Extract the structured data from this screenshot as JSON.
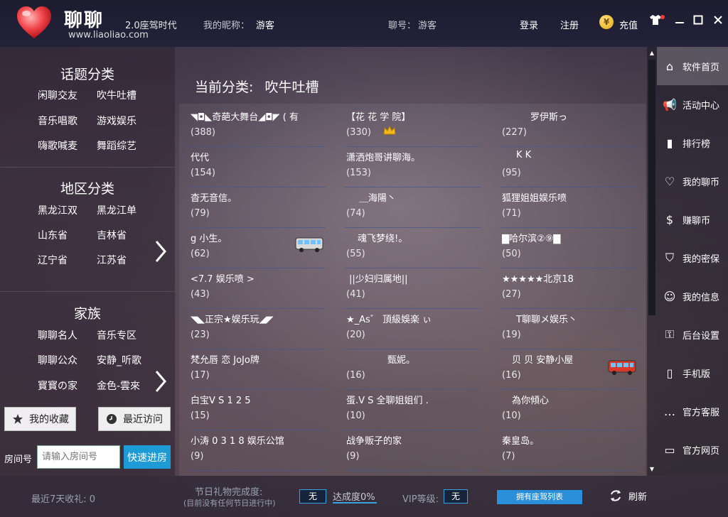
{
  "titlebar": {
    "brand": "聊聊",
    "version": "2.0座驾时代",
    "website": "www.liaoliao.com",
    "nick_label": "我的昵称：",
    "nick_value": "游客",
    "account_label": "聊号：",
    "account_value": "游客",
    "login": "登录",
    "register": "注册",
    "recharge": "充值",
    "coin_glyph": "¥"
  },
  "left": {
    "topics": {
      "title": "话题分类",
      "items": [
        "闲聊交友",
        "吹牛吐槽",
        "音乐唱歌",
        "游戏娱乐",
        "嗨歌喊麦",
        "舞蹈综艺"
      ]
    },
    "regions": {
      "title": "地区分类",
      "items": [
        "黑龙江双",
        "黑龙江单",
        "山东省",
        "吉林省",
        "辽宁省",
        "江苏省"
      ]
    },
    "family": {
      "title": "家族",
      "items": [
        "聊聊名人",
        "音乐专区",
        "聊聊公众",
        "安静_听歌",
        "寳寳の家",
        "金色-雲來"
      ]
    },
    "favorites": "我的收藏",
    "recent": "最近访问",
    "room_label": "房间号",
    "room_placeholder": "请输入房间号",
    "enter_room": "快速进房"
  },
  "main": {
    "current_label": "当前分类:",
    "current_value": "吹牛吐槽",
    "rooms": [
      {
        "name": "◥◘◣奇葩大舞台◢◘◤ ( 有",
        "count": "(388)"
      },
      {
        "name": "【花 花 学 院】",
        "count": "(330)"
      },
      {
        "name": "罗伊斯っ",
        "count": "(227)"
      },
      {
        "name": "代代",
        "count": "(154)"
      },
      {
        "name": "潇洒炮哥讲聊海。",
        "count": "(153)"
      },
      {
        "name": "K  K",
        "count": "(95)"
      },
      {
        "name": "杳无音信。",
        "count": "(79)"
      },
      {
        "name": "＿海陽丶",
        "count": "(74)"
      },
      {
        "name": "狐狸姐姐娱乐喷",
        "count": "(71)"
      },
      {
        "name": "g 小生。",
        "count": "(62)"
      },
      {
        "name": "魂飞梦绕!。",
        "count": "(55)"
      },
      {
        "name": "▇哈尔滨②⑨▇",
        "count": "(50)"
      },
      {
        "name": "<7.7 娱乐喷 >",
        "count": "(43)"
      },
      {
        "name": "||少妇归属地||",
        "count": "(41)"
      },
      {
        "name": "★★★★★北京18",
        "count": "(27)"
      },
      {
        "name": "◥◣正宗★娱乐玩◢◤",
        "count": "(23)"
      },
      {
        "name": "★_As゛ 頂級娛楽 ぃ",
        "count": "(20)"
      },
      {
        "name": "T聊聊メ娱乐丶",
        "count": "(19)"
      },
      {
        "name": "梵允唇 恋 JoJo牌",
        "count": "(17)"
      },
      {
        "name": "甄妮。",
        "count": "(16)"
      },
      {
        "name": "贝 贝  安静小屋",
        "count": "(16)"
      },
      {
        "name": "白宝V S 1 2 5",
        "count": "(15)"
      },
      {
        "name": "蛋.V S 全聊姐姐们 .",
        "count": "(10)"
      },
      {
        "name": "為你傾心",
        "count": "(10)"
      },
      {
        "name": "小涛 0 3 1 8 娱乐公馆",
        "count": "(9)"
      },
      {
        "name": "战争贩子的家",
        "count": "(9)"
      },
      {
        "name": "秦皇岛。",
        "count": "(7)"
      }
    ]
  },
  "right_nav": [
    {
      "label": "软件首页",
      "icon": "home-icon",
      "glyph": "⌂"
    },
    {
      "label": "活动中心",
      "icon": "megaphone-icon",
      "glyph": "📢"
    },
    {
      "label": "排行榜",
      "icon": "bar-chart-icon",
      "glyph": "▮"
    },
    {
      "label": "我的聊币",
      "icon": "heart-coin-icon",
      "glyph": "♡"
    },
    {
      "label": "赚聊币",
      "icon": "dollar-coin-icon",
      "glyph": "$"
    },
    {
      "label": "我的密保",
      "icon": "shield-icon",
      "glyph": "⛉"
    },
    {
      "label": "我的信息",
      "icon": "user-icon",
      "glyph": "☺"
    },
    {
      "label": "后台设置",
      "icon": "lock-icon",
      "glyph": "⚿"
    },
    {
      "label": "手机版",
      "icon": "phone-icon",
      "glyph": "▯"
    },
    {
      "label": "官方客服",
      "icon": "chat-icon",
      "glyph": "…"
    },
    {
      "label": "官方网页",
      "icon": "monitor-icon",
      "glyph": "▭"
    }
  ],
  "bottom": {
    "gifts_7days": "最近7天收礼: 0",
    "festival_title": "节日礼物完成度:",
    "festival_note": "(目前没有任何节日进行中)",
    "festival_value": "无",
    "progress": "达成度0%",
    "vip_label": "VIP等级:",
    "vip_value": "无",
    "own_car": "拥有座驾列表",
    "refresh": "刷新"
  },
  "colors": {
    "accent_blue": "#1e9ad6",
    "titlebar": "#1d1b2e",
    "row_divider": "#465a8c"
  }
}
